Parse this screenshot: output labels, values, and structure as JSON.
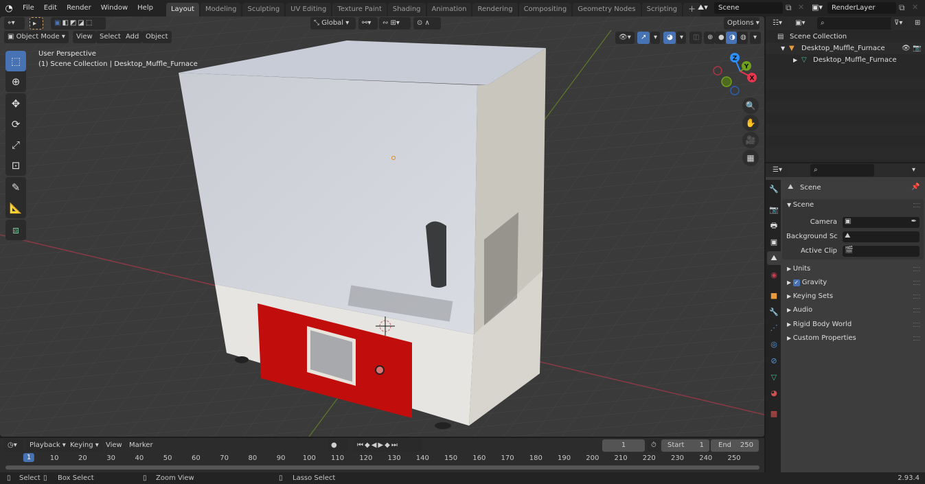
{
  "topbar": {
    "menus": [
      "File",
      "Edit",
      "Render",
      "Window",
      "Help"
    ],
    "workspaces": [
      "Layout",
      "Modeling",
      "Sculpting",
      "UV Editing",
      "Texture Paint",
      "Shading",
      "Animation",
      "Rendering",
      "Compositing",
      "Geometry Nodes",
      "Scripting"
    ],
    "active_workspace": "Layout",
    "add_tab": "+",
    "scene": "Scene",
    "view_layer": "RenderLayer"
  },
  "viewport": {
    "mode": "Object Mode",
    "menus": [
      "View",
      "Select",
      "Add",
      "Object"
    ],
    "transform_orientation": "Global",
    "options_label": "Options",
    "perspective_label": "User Perspective",
    "context_label": "(1) Scene Collection | Desktop_Muffle_Furnace",
    "gizmo_axes": [
      "X",
      "Y",
      "Z"
    ],
    "axis_colors": {
      "x": "#e8364f",
      "y": "#6fa11f",
      "z": "#2c8fff"
    },
    "tools": [
      "select-box",
      "cursor",
      "move",
      "rotate",
      "scale",
      "transform",
      "annotate",
      "measure",
      "add-cube"
    ]
  },
  "outliner": {
    "root": "Scene Collection",
    "items": [
      {
        "label": "Desktop_Muffle_Furnace",
        "type": "collection",
        "expanded": true
      },
      {
        "label": "Desktop_Muffle_Furnace",
        "type": "mesh-object",
        "expanded": false
      }
    ]
  },
  "properties": {
    "context_title": "Scene",
    "panel_title": "Scene",
    "fields": [
      {
        "label": "Camera",
        "value": ""
      },
      {
        "label": "Background Sce...",
        "value": ""
      },
      {
        "label": "Active Clip",
        "value": ""
      }
    ],
    "subpanels": [
      {
        "label": "Units"
      },
      {
        "label": "Gravity",
        "checkbox": true,
        "checked": true
      },
      {
        "label": "Keying Sets"
      },
      {
        "label": "Audio"
      },
      {
        "label": "Rigid Body World"
      },
      {
        "label": "Custom Properties"
      }
    ],
    "tabs": [
      "tool",
      "render",
      "output",
      "view-layer",
      "scene",
      "world",
      "object",
      "modifiers",
      "particles",
      "physics",
      "constraints",
      "data",
      "material",
      "texture"
    ],
    "active_tab": "scene"
  },
  "timeline": {
    "menus": [
      "Playback",
      "Keying",
      "View",
      "Marker"
    ],
    "current_frame": "1",
    "start_label": "Start",
    "start": "1",
    "end_label": "End",
    "end": "250",
    "ticks": [
      "1",
      "10",
      "20",
      "30",
      "40",
      "50",
      "60",
      "70",
      "80",
      "90",
      "100",
      "110",
      "120",
      "130",
      "140",
      "150",
      "160",
      "170",
      "180",
      "190",
      "200",
      "210",
      "220",
      "230",
      "240",
      "250"
    ]
  },
  "statusbar": {
    "hints": [
      "Select",
      "Box Select",
      "Zoom View",
      "Lasso Select"
    ],
    "version": "2.93.4"
  }
}
